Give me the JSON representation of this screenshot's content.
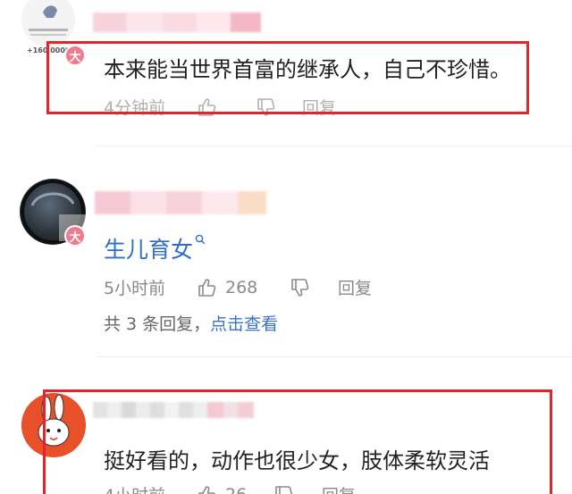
{
  "comments": [
    {
      "badge": "大",
      "text": "本来能当世界首富的继承人，自己不珍惜。",
      "time": "4分钟前",
      "reply": "回复",
      "avatar_caption": "+160 0000"
    },
    {
      "badge": "大",
      "text": "生儿育女",
      "time": "5小时前",
      "likes": "268",
      "reply": "回复",
      "replies_prefix": "共 3 条回复，",
      "replies_link": "点击查看"
    },
    {
      "text": "挺好看的，动作也很少女，肢体柔软灵活",
      "time": "4小时前",
      "likes": "26",
      "reply": "回复"
    }
  ],
  "colors": {
    "highlight_box": "#e0252b",
    "link": "#3a72c6",
    "badge": "#f07a8e"
  }
}
